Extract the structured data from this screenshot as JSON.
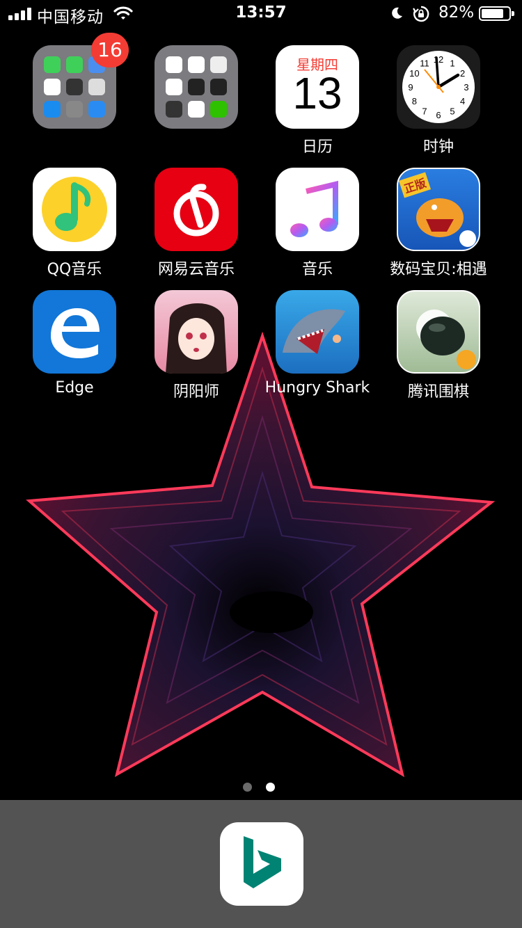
{
  "status_bar": {
    "carrier": "中国移动",
    "time": "13:57",
    "battery_percent": "82%",
    "battery_level": 0.82
  },
  "home": {
    "folder1_badge": "16",
    "apps": [
      {
        "label": ""
      },
      {
        "label": ""
      },
      {
        "label": "日历",
        "calendar_weekday": "星期四",
        "calendar_day": "13"
      },
      {
        "label": "时钟",
        "clock_numerals": [
          "12",
          "1",
          "2",
          "3",
          "4",
          "5",
          "6",
          "7",
          "8",
          "9",
          "10",
          "11"
        ]
      },
      {
        "label": "QQ音乐"
      },
      {
        "label": "网易云音乐"
      },
      {
        "label": "音乐"
      },
      {
        "label": "数码宝贝:相遇",
        "icon_tag": "正版"
      },
      {
        "label": "Edge"
      },
      {
        "label": "阴阳师"
      },
      {
        "label": "Hungry Shark"
      },
      {
        "label": "腾讯围棋"
      }
    ]
  },
  "page_indicator": {
    "count": 2,
    "active_index": 1
  },
  "dock": {
    "apps": [
      {
        "name": "bing"
      }
    ]
  },
  "colors": {
    "badge": "#f33c34",
    "dock_bg": "#535353"
  }
}
